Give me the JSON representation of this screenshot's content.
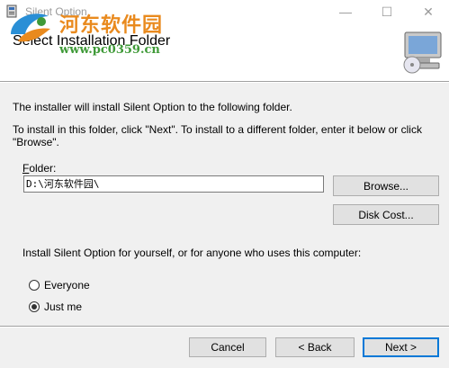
{
  "window": {
    "title": "Silent Option",
    "min_glyph": "—",
    "max_glyph": "☐",
    "close_glyph": "✕"
  },
  "banner": {
    "title": "Select Installation Folder",
    "watermark_title": "河东软件园",
    "watermark_url": "www.pc0359.cn"
  },
  "content": {
    "line1": "The installer will install Silent Option to the following folder.",
    "line2": "To install in this folder, click \"Next\". To install to a different folder, enter it below or click \"Browse\".",
    "folder_label_first": "F",
    "folder_label_rest": "older:",
    "folder_value": "D:\\河东软件园\\",
    "browse_label": "Browse...",
    "disk_cost_label": "Disk Cost...",
    "install_for_label": "Install Silent Option for yourself, or for anyone who uses this computer:",
    "radio_everyone": "Everyone",
    "radio_just_me": "Just me",
    "selected_option": "Just me"
  },
  "footer": {
    "cancel_label": "Cancel",
    "back_label": "< Back",
    "next_label": "Next >"
  },
  "colors": {
    "accent": "#0078d7",
    "watermark_orange": "#e98a1e",
    "watermark_green": "#3f9a38"
  },
  "icons": [
    "installer-app-icon",
    "computer-cd-icon",
    "watermark-logo"
  ]
}
